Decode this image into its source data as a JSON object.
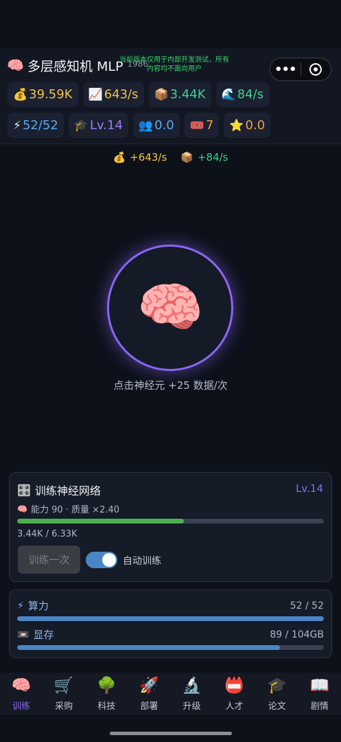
{
  "header": {
    "title_icon": "brain-icon",
    "title_emoji": "🧠",
    "title": "多层感知机 MLP",
    "version": "1986",
    "dev_note": "当前版本仅用于内部开发测试，所有内容均不面向用户",
    "capsule": {
      "more_icon": "more-dots-icon",
      "close_icon": "close-circle-icon"
    }
  },
  "stats_row1": [
    {
      "icon": "money-bag-icon",
      "emoji": "💰",
      "value": "39.59K",
      "color": "#f1c24a"
    },
    {
      "icon": "chart-up-icon",
      "emoji": "📈",
      "value": "643/s",
      "color": "#f1c24a"
    },
    {
      "icon": "package-icon",
      "emoji": "📦",
      "value": "3.44K",
      "color": "#3fcf8e"
    },
    {
      "icon": "wave-icon",
      "emoji": "🌊",
      "value": "84/s",
      "color": "#3fcf8e"
    }
  ],
  "stats_row2": [
    {
      "icon": "lightning-icon",
      "emoji": "⚡",
      "value": "52/52",
      "color": "#5aa7f0"
    },
    {
      "icon": "grad-cap-icon",
      "emoji": "🎓",
      "value": "Lv.14",
      "color": "#9b7cf6"
    },
    {
      "icon": "people-icon",
      "emoji": "👥",
      "value": "0.0",
      "color": "#5aa7f0"
    },
    {
      "icon": "ticket-icon",
      "emoji": "🎟️",
      "value": "7",
      "color": "#f0a040"
    },
    {
      "icon": "star-icon",
      "emoji": "⭐",
      "value": "0.0",
      "color": "#f0a040"
    }
  ],
  "rates": [
    {
      "icon": "money-bag-icon",
      "emoji": "💰",
      "value": "+643/s",
      "color": "#f1c24a"
    },
    {
      "icon": "package-icon",
      "emoji": "📦",
      "value": "+84/s",
      "color": "#3fcf8e"
    }
  ],
  "neuron": {
    "emoji": "🧠",
    "hint": "点击神经元 +25 数据/次"
  },
  "train_panel": {
    "title_emoji": "🎛️",
    "title": "训练神经网络",
    "level": "Lv.14",
    "sub_emoji": "🧠",
    "sub": "能力 90 · 质量 ×2.40",
    "progress_text": "3.44K / 6.33K",
    "progress_fraction": 0.543,
    "progress_color": "#4caf50",
    "train_button": "训练一次",
    "auto_label": "自动训练",
    "auto_on": true
  },
  "resources": [
    {
      "icon": "lightning-icon",
      "emoji": "⚡",
      "name": "算力",
      "value": "52 / 52",
      "fraction": 1.0,
      "color": "#4a86c5"
    },
    {
      "icon": "memory-icon",
      "emoji": "📼",
      "name": "显存",
      "value": "89 / 104GB",
      "fraction": 0.856,
      "color": "#4a86c5"
    }
  ],
  "tabs": [
    {
      "icon": "brain-icon",
      "emoji": "🧠",
      "label": "训练",
      "active": true
    },
    {
      "icon": "cart-icon",
      "emoji": "🛒",
      "label": "采购"
    },
    {
      "icon": "tree-icon",
      "emoji": "🌳",
      "label": "科技"
    },
    {
      "icon": "rocket-icon",
      "emoji": "🚀",
      "label": "部署"
    },
    {
      "icon": "microscope-icon",
      "emoji": "🔬",
      "label": "升级"
    },
    {
      "icon": "person-card-icon",
      "emoji": "📛",
      "label": "人才"
    },
    {
      "icon": "grad-cap-icon",
      "emoji": "🎓",
      "label": "论文"
    },
    {
      "icon": "book-icon",
      "emoji": "📖",
      "label": "剧情"
    }
  ]
}
